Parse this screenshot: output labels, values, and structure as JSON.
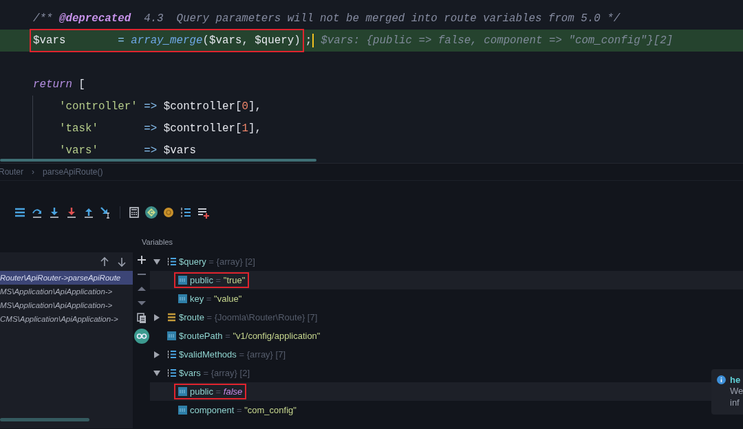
{
  "editor": {
    "lines": [
      {
        "kind": "code",
        "tokens": [
          {
            "text": "/** ",
            "kind": "comment"
          },
          {
            "text": "@deprecated",
            "kind": "doctag"
          },
          {
            "text": "  4.3  Query parameters will not be merged into route variables from 5.0 */",
            "kind": "comment"
          }
        ]
      },
      {
        "kind": "code",
        "current": true,
        "caret": true,
        "segments": [
          {
            "boxed": true,
            "tokens": [
              {
                "text": "$vars",
                "kind": "var"
              },
              {
                "text": "        = ",
                "kind": "op"
              },
              {
                "text": "array_merge",
                "kind": "func"
              },
              {
                "text": "(",
                "kind": "punc"
              },
              {
                "text": "$vars",
                "kind": "var"
              },
              {
                "text": ", ",
                "kind": "punc"
              },
              {
                "text": "$query",
                "kind": "var"
              },
              {
                "text": ")",
                "kind": "punc"
              }
            ]
          },
          {
            "boxed": false,
            "tokens": [
              {
                "text": ";",
                "kind": "punc"
              }
            ]
          }
        ],
        "hint": "$vars: {public => false, component => \"com_config\"}[2]"
      },
      {
        "kind": "blank"
      },
      {
        "kind": "code",
        "tokens": [
          {
            "text": "return",
            "kind": "keyword"
          },
          {
            "text": " [",
            "kind": "punc"
          }
        ]
      },
      {
        "kind": "code",
        "indent": true,
        "tokens": [
          {
            "text": "'controller'",
            "kind": "string"
          },
          {
            "text": " => ",
            "kind": "op"
          },
          {
            "text": "$controller",
            "kind": "var"
          },
          {
            "text": "[",
            "kind": "punc"
          },
          {
            "text": "0",
            "kind": "number"
          },
          {
            "text": "],",
            "kind": "punc"
          }
        ]
      },
      {
        "kind": "code",
        "indent": true,
        "tokens": [
          {
            "text": "'task'",
            "kind": "string"
          },
          {
            "text": "       => ",
            "kind": "op"
          },
          {
            "text": "$controller",
            "kind": "var"
          },
          {
            "text": "[",
            "kind": "punc"
          },
          {
            "text": "1",
            "kind": "number"
          },
          {
            "text": "],",
            "kind": "punc"
          }
        ]
      },
      {
        "kind": "code",
        "indent": true,
        "tokens": [
          {
            "text": "'vars'",
            "kind": "string"
          },
          {
            "text": "       => ",
            "kind": "op"
          },
          {
            "text": "$vars",
            "kind": "var"
          }
        ]
      }
    ]
  },
  "breadcrumb": [
    "Router",
    "›",
    "parseApiRoute()"
  ],
  "toolbar": [
    {
      "kind": "lines"
    },
    {
      "kind": "step-over"
    },
    {
      "kind": "step-into"
    },
    {
      "kind": "force-step-into"
    },
    {
      "kind": "step-out"
    },
    {
      "kind": "run-to-cursor"
    },
    {
      "kind": "separator"
    },
    {
      "kind": "calculator"
    },
    {
      "kind": "c-circle"
    },
    {
      "kind": "disc"
    },
    {
      "kind": "numbered-list"
    },
    {
      "kind": "add-list"
    }
  ],
  "variables_title": "Variables",
  "frames": [
    {
      "label": "Router\\ApiRouter->parseApiRoute",
      "selected": true
    },
    {
      "label": "MS\\Application\\ApiApplication->",
      "selected": false
    },
    {
      "label": "MS\\Application\\ApiApplication->",
      "selected": false
    },
    {
      "label": "CMS\\Application\\ApiApplication->",
      "selected": false
    }
  ],
  "variables": [
    {
      "kind": "array",
      "name": "$query",
      "sep": "=",
      "value": {
        "text": "{array} [2]",
        "kind": "type"
      },
      "expanded": true,
      "boxed": false,
      "children": [
        {
          "kind": "scalar",
          "name": "public",
          "sep": "=",
          "value": {
            "text": "\"true\"",
            "kind": "string"
          },
          "boxed": true
        },
        {
          "kind": "scalar",
          "name": "key",
          "sep": "=",
          "value": {
            "text": "\"value\"",
            "kind": "string"
          },
          "boxed": false
        }
      ]
    },
    {
      "kind": "object",
      "name": "$route",
      "sep": "=",
      "value": {
        "text": "{Joomla\\Router\\Route} [7]",
        "kind": "type"
      },
      "expanded": false,
      "boxed": false
    },
    {
      "kind": "scalar",
      "name": "$routePath",
      "sep": "=",
      "value": {
        "text": "\"v1/config/application\"",
        "kind": "string"
      },
      "boxed": false
    },
    {
      "kind": "array",
      "name": "$validMethods",
      "sep": "=",
      "value": {
        "text": "{array} [7]",
        "kind": "type"
      },
      "expanded": false,
      "boxed": false
    },
    {
      "kind": "array",
      "name": "$vars",
      "sep": "=",
      "value": {
        "text": "{array} [2]",
        "kind": "type"
      },
      "expanded": true,
      "boxed": false,
      "children": [
        {
          "kind": "scalar",
          "name": "public",
          "sep": "=",
          "value": {
            "text": "false",
            "kind": "bool"
          },
          "boxed": true
        },
        {
          "kind": "scalar",
          "name": "component",
          "sep": "=",
          "value": {
            "text": "\"com_config\"",
            "kind": "string"
          },
          "boxed": false
        }
      ]
    }
  ],
  "notification": {
    "title": "he",
    "lines": [
      "We",
      "inf"
    ]
  }
}
